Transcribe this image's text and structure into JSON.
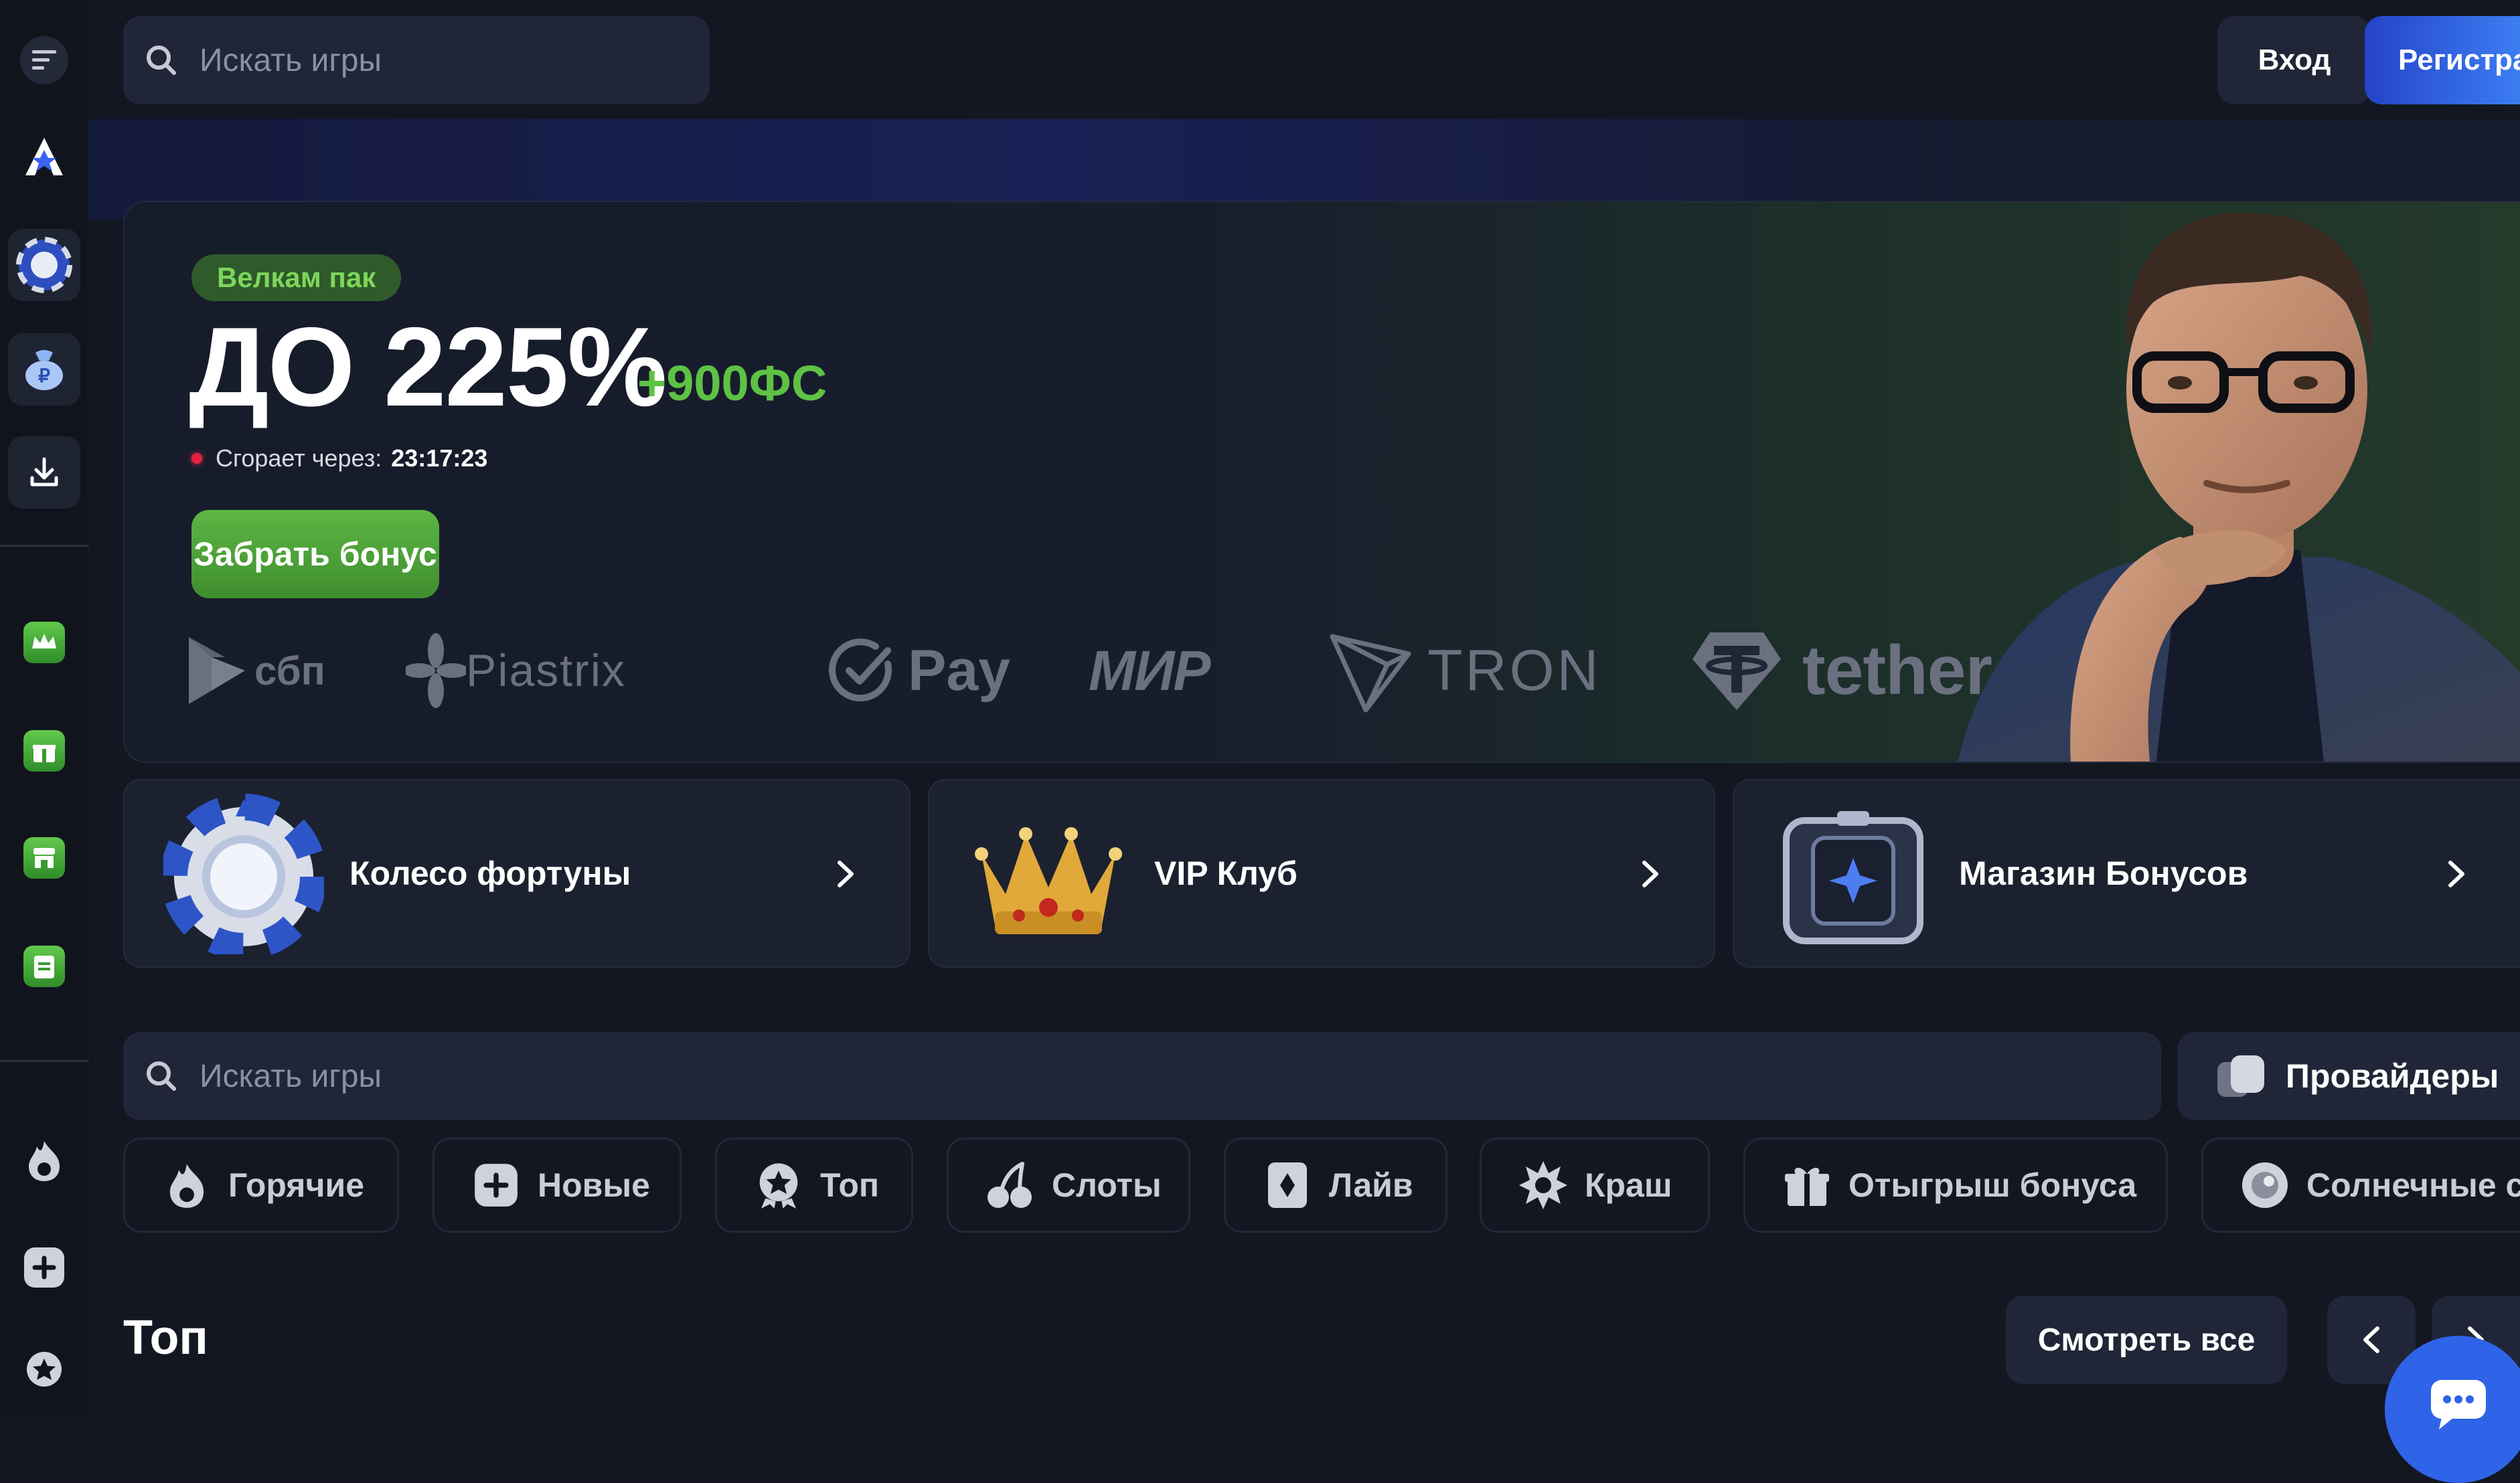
{
  "sidebar": {
    "icons": [
      "menu-icon",
      "logo-icon",
      "fortune-wheel-icon",
      "money-bag-icon",
      "download-icon",
      "vip-crown-icon",
      "gift-icon",
      "shop-icon",
      "tasks-icon",
      "fire-icon",
      "plus-icon",
      "star-badge-icon"
    ]
  },
  "topbar": {
    "search_placeholder": "Искать игры",
    "login_label": "Вход",
    "register_label": "Регистрация"
  },
  "hero": {
    "badge": "Велкам пак",
    "headline": "ДО 225%",
    "extra": "+900ФС",
    "timer_label": "Сгорает через:",
    "timer_value": "23:17:23",
    "cta": "Забрать бонус",
    "payments": [
      "сбп",
      "Piastrix",
      "Pay",
      "МИР",
      "TRON",
      "tether"
    ]
  },
  "promos": [
    {
      "label": "Колесо фортуны"
    },
    {
      "label": "VIP Клуб"
    },
    {
      "label": "Магазин Бонусов"
    }
  ],
  "games": {
    "search_placeholder": "Искать игры",
    "providers_label": "Провайдеры",
    "categories": [
      {
        "label": "Горячие",
        "icon": "fire-icon"
      },
      {
        "label": "Новые",
        "icon": "plus-icon"
      },
      {
        "label": "Топ",
        "icon": "star-badge-icon"
      },
      {
        "label": "Слоты",
        "icon": "cherries-icon"
      },
      {
        "label": "Лайв",
        "icon": "card-icon"
      },
      {
        "label": "Краш",
        "icon": "explosion-icon"
      },
      {
        "label": "Отыгрыш бонуса",
        "icon": "gift-icon"
      },
      {
        "label": "Солнечные с",
        "icon": "sun-icon"
      }
    ]
  },
  "section": {
    "title": "Топ",
    "view_all": "Смотреть все"
  },
  "colors": {
    "background": "#131722",
    "accent_green": "#5ec244",
    "accent_blue": "#2f63e8"
  }
}
